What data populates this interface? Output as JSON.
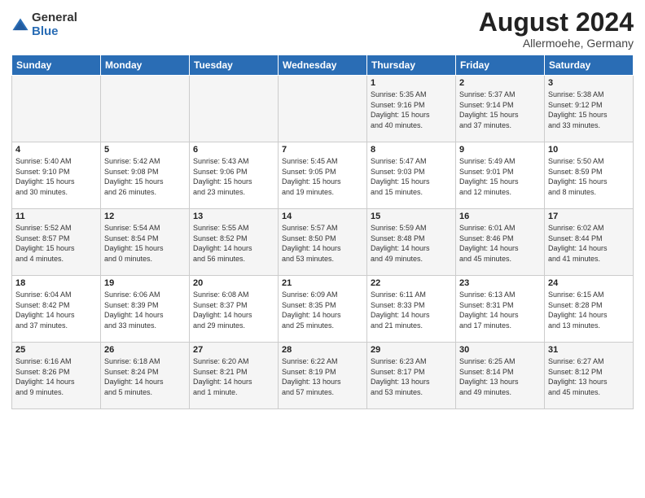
{
  "header": {
    "logo_general": "General",
    "logo_blue": "Blue",
    "month_title": "August 2024",
    "subtitle": "Allermoehe, Germany"
  },
  "weekdays": [
    "Sunday",
    "Monday",
    "Tuesday",
    "Wednesday",
    "Thursday",
    "Friday",
    "Saturday"
  ],
  "weeks": [
    [
      {
        "day": "",
        "info": ""
      },
      {
        "day": "",
        "info": ""
      },
      {
        "day": "",
        "info": ""
      },
      {
        "day": "",
        "info": ""
      },
      {
        "day": "1",
        "info": "Sunrise: 5:35 AM\nSunset: 9:16 PM\nDaylight: 15 hours\nand 40 minutes."
      },
      {
        "day": "2",
        "info": "Sunrise: 5:37 AM\nSunset: 9:14 PM\nDaylight: 15 hours\nand 37 minutes."
      },
      {
        "day": "3",
        "info": "Sunrise: 5:38 AM\nSunset: 9:12 PM\nDaylight: 15 hours\nand 33 minutes."
      }
    ],
    [
      {
        "day": "4",
        "info": "Sunrise: 5:40 AM\nSunset: 9:10 PM\nDaylight: 15 hours\nand 30 minutes."
      },
      {
        "day": "5",
        "info": "Sunrise: 5:42 AM\nSunset: 9:08 PM\nDaylight: 15 hours\nand 26 minutes."
      },
      {
        "day": "6",
        "info": "Sunrise: 5:43 AM\nSunset: 9:06 PM\nDaylight: 15 hours\nand 23 minutes."
      },
      {
        "day": "7",
        "info": "Sunrise: 5:45 AM\nSunset: 9:05 PM\nDaylight: 15 hours\nand 19 minutes."
      },
      {
        "day": "8",
        "info": "Sunrise: 5:47 AM\nSunset: 9:03 PM\nDaylight: 15 hours\nand 15 minutes."
      },
      {
        "day": "9",
        "info": "Sunrise: 5:49 AM\nSunset: 9:01 PM\nDaylight: 15 hours\nand 12 minutes."
      },
      {
        "day": "10",
        "info": "Sunrise: 5:50 AM\nSunset: 8:59 PM\nDaylight: 15 hours\nand 8 minutes."
      }
    ],
    [
      {
        "day": "11",
        "info": "Sunrise: 5:52 AM\nSunset: 8:57 PM\nDaylight: 15 hours\nand 4 minutes."
      },
      {
        "day": "12",
        "info": "Sunrise: 5:54 AM\nSunset: 8:54 PM\nDaylight: 15 hours\nand 0 minutes."
      },
      {
        "day": "13",
        "info": "Sunrise: 5:55 AM\nSunset: 8:52 PM\nDaylight: 14 hours\nand 56 minutes."
      },
      {
        "day": "14",
        "info": "Sunrise: 5:57 AM\nSunset: 8:50 PM\nDaylight: 14 hours\nand 53 minutes."
      },
      {
        "day": "15",
        "info": "Sunrise: 5:59 AM\nSunset: 8:48 PM\nDaylight: 14 hours\nand 49 minutes."
      },
      {
        "day": "16",
        "info": "Sunrise: 6:01 AM\nSunset: 8:46 PM\nDaylight: 14 hours\nand 45 minutes."
      },
      {
        "day": "17",
        "info": "Sunrise: 6:02 AM\nSunset: 8:44 PM\nDaylight: 14 hours\nand 41 minutes."
      }
    ],
    [
      {
        "day": "18",
        "info": "Sunrise: 6:04 AM\nSunset: 8:42 PM\nDaylight: 14 hours\nand 37 minutes."
      },
      {
        "day": "19",
        "info": "Sunrise: 6:06 AM\nSunset: 8:39 PM\nDaylight: 14 hours\nand 33 minutes."
      },
      {
        "day": "20",
        "info": "Sunrise: 6:08 AM\nSunset: 8:37 PM\nDaylight: 14 hours\nand 29 minutes."
      },
      {
        "day": "21",
        "info": "Sunrise: 6:09 AM\nSunset: 8:35 PM\nDaylight: 14 hours\nand 25 minutes."
      },
      {
        "day": "22",
        "info": "Sunrise: 6:11 AM\nSunset: 8:33 PM\nDaylight: 14 hours\nand 21 minutes."
      },
      {
        "day": "23",
        "info": "Sunrise: 6:13 AM\nSunset: 8:31 PM\nDaylight: 14 hours\nand 17 minutes."
      },
      {
        "day": "24",
        "info": "Sunrise: 6:15 AM\nSunset: 8:28 PM\nDaylight: 14 hours\nand 13 minutes."
      }
    ],
    [
      {
        "day": "25",
        "info": "Sunrise: 6:16 AM\nSunset: 8:26 PM\nDaylight: 14 hours\nand 9 minutes."
      },
      {
        "day": "26",
        "info": "Sunrise: 6:18 AM\nSunset: 8:24 PM\nDaylight: 14 hours\nand 5 minutes."
      },
      {
        "day": "27",
        "info": "Sunrise: 6:20 AM\nSunset: 8:21 PM\nDaylight: 14 hours\nand 1 minute."
      },
      {
        "day": "28",
        "info": "Sunrise: 6:22 AM\nSunset: 8:19 PM\nDaylight: 13 hours\nand 57 minutes."
      },
      {
        "day": "29",
        "info": "Sunrise: 6:23 AM\nSunset: 8:17 PM\nDaylight: 13 hours\nand 53 minutes."
      },
      {
        "day": "30",
        "info": "Sunrise: 6:25 AM\nSunset: 8:14 PM\nDaylight: 13 hours\nand 49 minutes."
      },
      {
        "day": "31",
        "info": "Sunrise: 6:27 AM\nSunset: 8:12 PM\nDaylight: 13 hours\nand 45 minutes."
      }
    ]
  ]
}
